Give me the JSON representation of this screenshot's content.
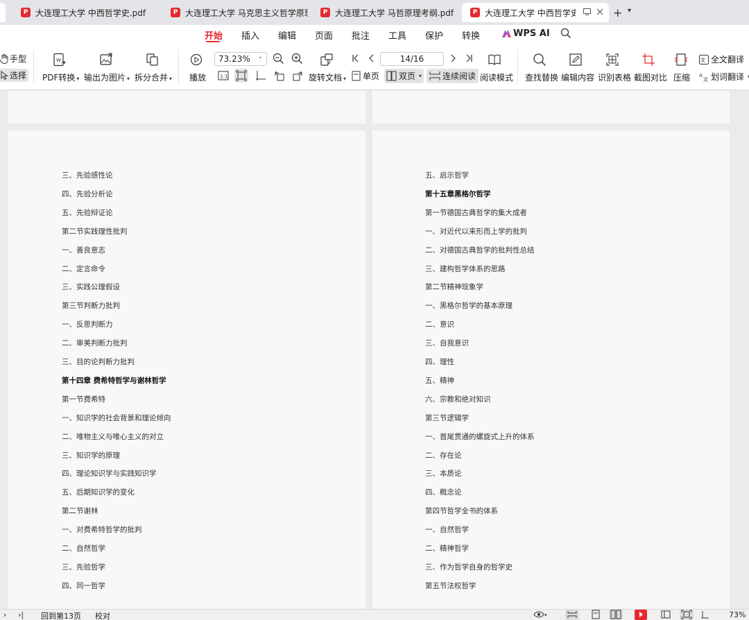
{
  "tabs": [
    {
      "title": "大连理工大学 中西哲学史.pdf"
    },
    {
      "title": "大连理工大学 马克思主义哲学原理.pdf"
    },
    {
      "title": "大连理工大学 马哲原理考纲.pdf"
    },
    {
      "title": "大连理工大学 中西哲学史考纲.pdf"
    }
  ],
  "menu": {
    "items": [
      "开始",
      "插入",
      "编辑",
      "页面",
      "批注",
      "工具",
      "保护",
      "转换"
    ],
    "ai": "WPS AI"
  },
  "toolbar": {
    "hand": "手型",
    "select": "选择",
    "pdf_convert": "PDF转换",
    "export_image": "输出为图片",
    "split_merge": "拆分合并",
    "play": "播放",
    "zoom_value": "73.23%",
    "rotate_doc": "旋转文档",
    "single_page": "单页",
    "double_page": "双页",
    "continuous": "连续阅读",
    "page_value": "14/16",
    "reading_mode": "阅读模式",
    "find_replace": "查找替换",
    "edit_content": "编辑内容",
    "recognize_table": "识别表格",
    "screenshot_compare": "截图对比",
    "compress": "压缩",
    "full_translate": "全文翻译",
    "word_translate": "划词翻译"
  },
  "left_page": [
    {
      "text": "三、先验感性论"
    },
    {
      "text": "四、先验分析论"
    },
    {
      "text": "五、先验辩证论"
    },
    {
      "text": "第二节实践理性批判"
    },
    {
      "text": "一、善良意志"
    },
    {
      "text": "二、定言命令"
    },
    {
      "text": "三、实践公理假设"
    },
    {
      "text": "第三节判断力批判"
    },
    {
      "text": "一、反思判断力"
    },
    {
      "text": "二、审美判断力批判"
    },
    {
      "text": "三、目的论判断力批判"
    },
    {
      "text": "第十四章  费希特哲学与谢林哲学",
      "bold": true
    },
    {
      "text": "第一节费希特"
    },
    {
      "text": "一、知识学的社会背景和理论倾向"
    },
    {
      "text": "二、唯物主义与唯心主义的对立"
    },
    {
      "text": "三、知识学的原理"
    },
    {
      "text": "四、理论知识学与实践知识学"
    },
    {
      "text": "五、后期知识学的变化"
    },
    {
      "text": "第二节谢林"
    },
    {
      "text": "一、对费希特哲学的批判"
    },
    {
      "text": "二、自然哲学"
    },
    {
      "text": "三、先验哲学"
    },
    {
      "text": "四、同一哲学"
    }
  ],
  "right_page": [
    {
      "text": "五、启示哲学"
    },
    {
      "text": "第十五章黑格尔哲学",
      "bold": true
    },
    {
      "text": "第一节德国古典哲学的集大成者"
    },
    {
      "text": "一、对近代以来形而上学的批判"
    },
    {
      "text": "二、对德国古典哲学的批判性总结"
    },
    {
      "text": "三、建构哲学体系的思路"
    },
    {
      "text": "第二节精神现象学"
    },
    {
      "text": "一、黑格尔哲学的基本原理"
    },
    {
      "text": "二、意识"
    },
    {
      "text": "三、自我意识"
    },
    {
      "text": "四、理性"
    },
    {
      "text": "五、精神"
    },
    {
      "text": "六、宗教和绝对知识"
    },
    {
      "text": "第三节逻辑学"
    },
    {
      "text": "一、首尾贯通的螺旋式上升的体系"
    },
    {
      "text": "二、存在论"
    },
    {
      "text": "三、本质论"
    },
    {
      "text": "四、概念论"
    },
    {
      "text": "第四节哲学全书的体系"
    },
    {
      "text": "一、自然哲学"
    },
    {
      "text": "二、精神哲学"
    },
    {
      "text": "三、作为哲学自身的哲学史"
    },
    {
      "text": "第五节法权哲学"
    }
  ],
  "status": {
    "goto_page": "回到第13页",
    "proofread": "校对",
    "zoom": "73%"
  },
  "colors": {
    "accent": "#e42a2f",
    "page": "#f8f8f8",
    "background": "#ebebec"
  }
}
